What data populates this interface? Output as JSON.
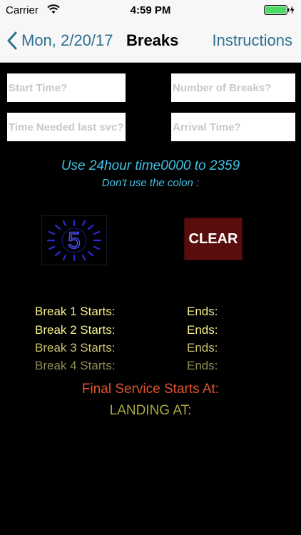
{
  "status_bar": {
    "carrier": "Carrier",
    "time": "4:59 PM"
  },
  "nav": {
    "back_label": "Mon, 2/20/17",
    "title": "Breaks",
    "right_button": "Instructions"
  },
  "inputs": {
    "start_time": {
      "placeholder": "Start Time?",
      "value": ""
    },
    "breaks_count": {
      "placeholder": "Number of Breaks?",
      "value": ""
    },
    "time_needed": {
      "placeholder": "Time Needed last svc?",
      "value": ""
    },
    "arrival_time": {
      "placeholder": "Arrival Time?",
      "value": ""
    }
  },
  "instructions": {
    "main": "Use 24hour time0000 to 2359",
    "sub": "Don't use the colon :"
  },
  "buttons": {
    "calc_digit": "5",
    "clear": "CLEAR"
  },
  "results": {
    "breaks": [
      {
        "start": "Break 1 Starts:",
        "end": "Ends:"
      },
      {
        "start": "Break 2 Starts:",
        "end": "Ends:"
      },
      {
        "start": "Break 3 Starts:",
        "end": "Ends:"
      },
      {
        "start": "Break 4 Starts:",
        "end": "Ends:"
      }
    ],
    "final_service": "Final Service Starts At:",
    "landing": "LANDING AT:"
  },
  "colors": {
    "nav_accent": "#2f6f91",
    "instructions": "#3ec3e6",
    "clear_bg": "#5a0d0d",
    "final_service": "#e0542c",
    "landing": "#a8a93e",
    "battery": "#4cd964"
  },
  "icons": {
    "back": "chevron-left-icon",
    "wifi": "wifi-icon",
    "battery": "battery-icon",
    "calc": "sunburst-digit-icon"
  }
}
